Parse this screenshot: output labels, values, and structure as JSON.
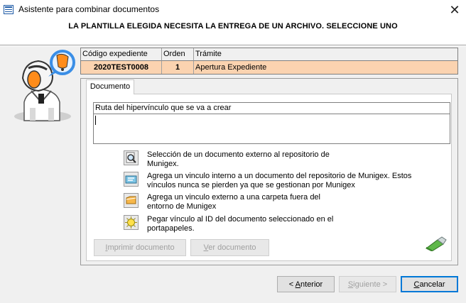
{
  "window": {
    "title": "Asistente para combinar documentos",
    "close_glyph": "✕",
    "icon": "form-window-icon"
  },
  "header": {
    "text": "LA PLANTILLA ELEGIDA NECESITA LA ENTREGA DE UN ARCHIVO. SELECCIONE UNO"
  },
  "record": {
    "columns": [
      "Código expediente",
      "Orden",
      "Trámite"
    ],
    "row": [
      "2020TEST0008",
      "1",
      "Apertura Expediente"
    ]
  },
  "tab": {
    "label": "Documento"
  },
  "field": {
    "label": "Ruta del hipervínculo que se va a crear",
    "value": ""
  },
  "options": [
    {
      "icon": "magnifier-document-icon",
      "text_line1": "Selección de un documento externo al repositorio de",
      "text_line2": "Munigex."
    },
    {
      "icon": "internal-link-icon",
      "text_line1": "Agrega un vinculo interno a un documento del repositorio de Munigex. Estos",
      "text_line2": "vínculos nunca se pierden ya que se gestionan por Munigex"
    },
    {
      "icon": "folder-link-icon",
      "text_line1": "Agrega un vinculo externo a una carpeta fuera del",
      "text_line2": "entorno de Munigex"
    },
    {
      "icon": "paste-id-icon",
      "text_line1": "Pegar vínculo al ID del documento seleccionado en el",
      "text_line2": "portapapeles."
    }
  ],
  "actions": {
    "print_prefix": "I",
    "print_rest": "mprimir documento",
    "view_prefix": "V",
    "view_rest": "er documento"
  },
  "footer": {
    "prev_prefix": "< ",
    "prev_ul": "A",
    "prev_rest": "nterior",
    "next_ul": "S",
    "next_rest": "iguiente >",
    "cancel_ul": "C",
    "cancel_rest": "ancelar"
  },
  "colors": {
    "record_row_bg": "#fbd3b0",
    "accent": "#0078d7"
  }
}
